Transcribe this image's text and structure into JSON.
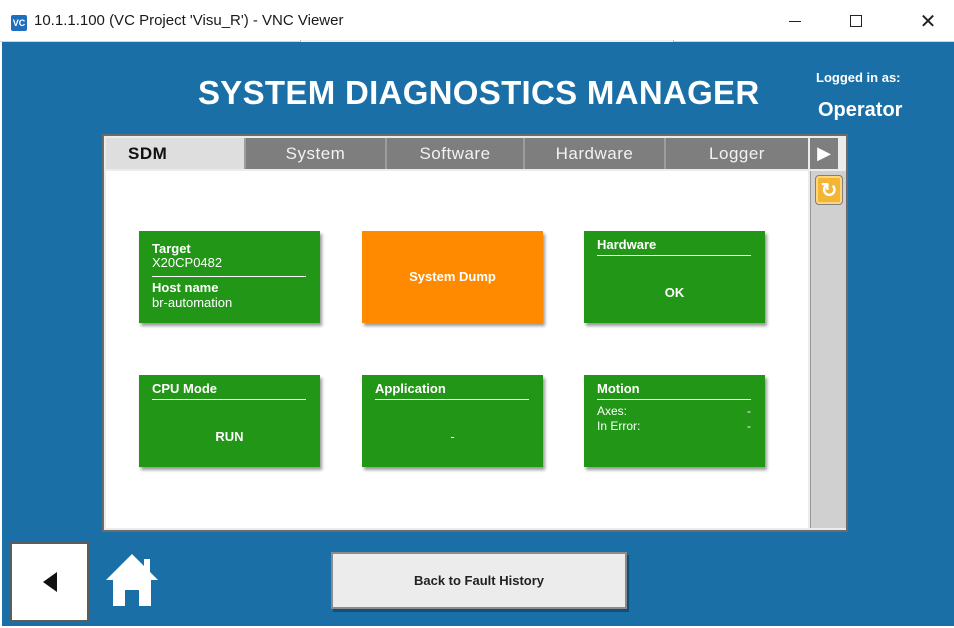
{
  "window": {
    "app_icon": "VC",
    "title": "10.1.1.100 (VC Project 'Visu_R') - VNC Viewer",
    "minimize": "minimize-icon",
    "maximize": "maximize-icon",
    "close_glyph": "✕"
  },
  "header": {
    "title": "SYSTEM DIAGNOSTICS MANAGER",
    "logged_in_label": "Logged in as:",
    "user": "Operator"
  },
  "tabs": [
    "SDM",
    "System",
    "Software",
    "Hardware",
    "Logger"
  ],
  "tab_scroll_glyph": "▶",
  "refresh_glyph": "↻",
  "tiles": {
    "target": {
      "title": "Target",
      "value": "X20CP0482",
      "host_title": "Host name",
      "host_value": "br-automation"
    },
    "system_dump": {
      "label": "System Dump"
    },
    "hardware": {
      "title": "Hardware",
      "value": "OK"
    },
    "cpu_mode": {
      "title": "CPU Mode",
      "value": "RUN"
    },
    "application": {
      "title": "Application",
      "value": "-"
    },
    "motion": {
      "title": "Motion",
      "axes_label": "Axes:",
      "axes_value": "-",
      "error_label": "In Error:",
      "error_value": "-"
    }
  },
  "footer": {
    "back_glyph": "◀",
    "fault_history_label": "Back to Fault History"
  },
  "colors": {
    "background": "#1a6fa7",
    "tile_ok": "#229616",
    "tile_action": "#ff8a00"
  }
}
